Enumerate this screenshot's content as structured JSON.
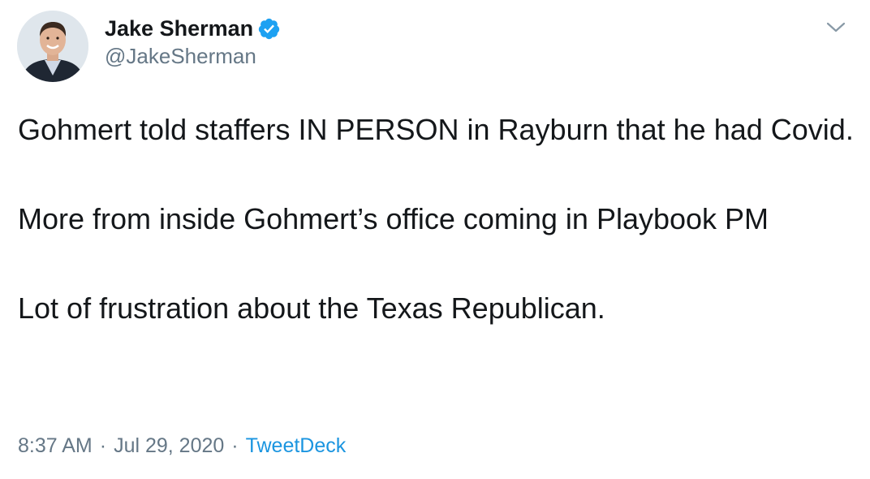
{
  "tweet": {
    "author": {
      "display_name": "Jake Sherman",
      "handle": "@JakeSherman",
      "verified": true,
      "avatar_icon": "profile-photo"
    },
    "menu_icon": "chevron-down-icon",
    "paragraphs": [
      "Gohmert told staffers IN PERSON in Rayburn that he had Covid.",
      "More from inside Gohmert’s office coming in Playbook PM",
      "Lot of frustration about the Texas Republican."
    ],
    "meta": {
      "time": "8:37 AM",
      "separator": "·",
      "date": "Jul 29, 2020",
      "source": "TweetDeck"
    }
  },
  "colors": {
    "text": "#14171a",
    "secondary": "#657786",
    "link": "#1b95e0",
    "verified": "#1da1f2"
  }
}
